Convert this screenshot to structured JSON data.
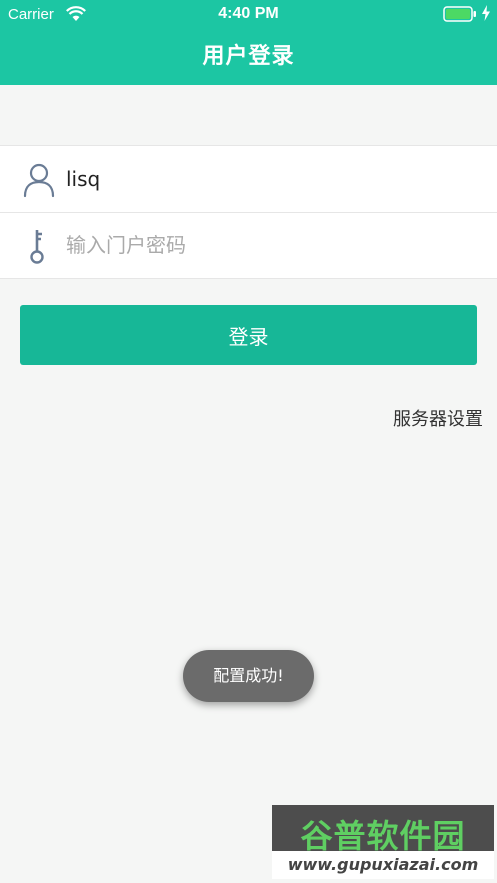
{
  "status_bar": {
    "carrier": "Carrier",
    "time": "4:40 PM",
    "wifi_icon": "wifi-icon",
    "battery_icon": "battery-icon",
    "charge_icon": "charging-bolt-icon"
  },
  "nav": {
    "title": "用户登录"
  },
  "form": {
    "username": {
      "icon": "user-icon",
      "value": "lisq",
      "placeholder": ""
    },
    "password": {
      "icon": "key-icon",
      "value": "",
      "placeholder": "输入门户密码"
    }
  },
  "login_button_label": "登录",
  "server_settings_label": "服务器设置",
  "toast": "配置成功!",
  "watermark": {
    "logo": "谷普软件园",
    "url": "www.gupuxiazai.com"
  },
  "colors": {
    "header": "#1cc6a3",
    "button": "#17b797",
    "background": "#f5f6f5",
    "toast": "#6b6b6b"
  }
}
